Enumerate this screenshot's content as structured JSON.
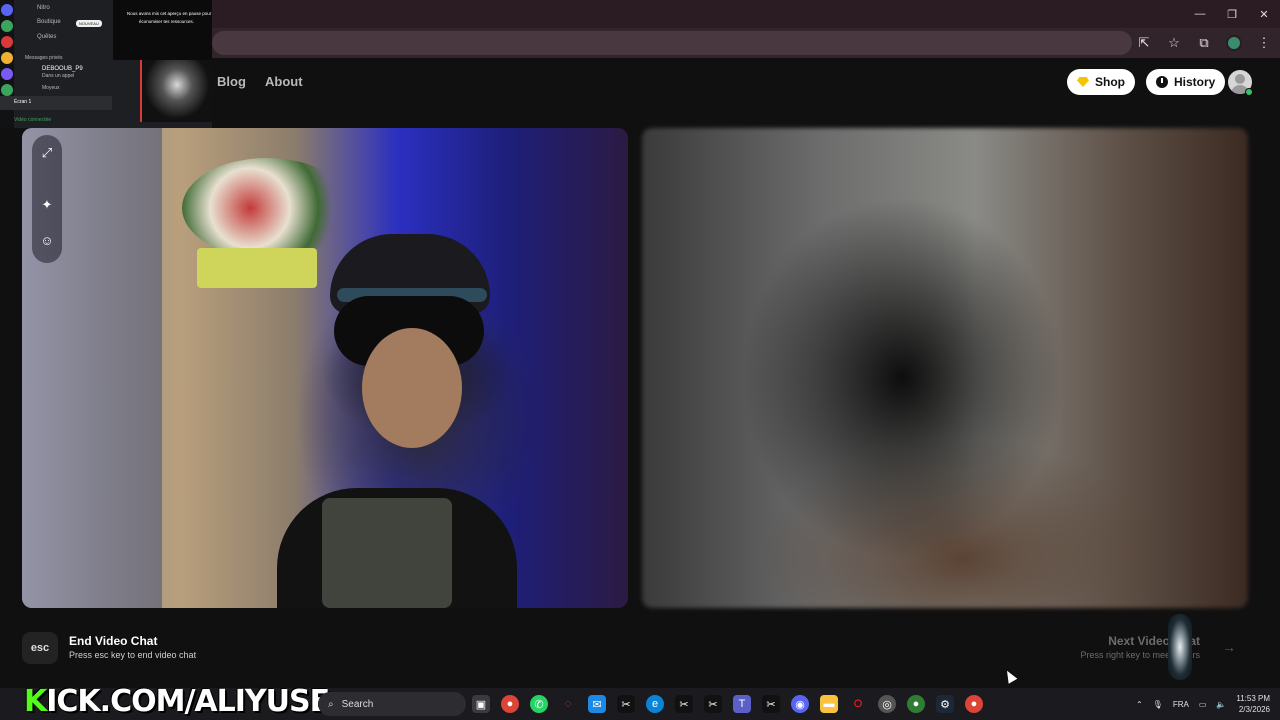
{
  "site_nav": {
    "blog": "Blog",
    "about": "About",
    "shop": "Shop",
    "history": "History"
  },
  "controls": {
    "end_key": "esc",
    "end_title": "End Video Chat",
    "end_sub": "Press esc key to end video chat",
    "next_title": "Next Video Chat",
    "next_sub": "Press right key to meet others"
  },
  "discord": {
    "nitro": "Nitro",
    "boutique": "Boutique",
    "badge_new": "NOUVEAU",
    "quetes": "Quêtes",
    "dm_header": "Messages privés",
    "dm_user": "DEBOOUB_P9",
    "dm_status": "Dans un appel",
    "dm_group": "Moyeux",
    "screen": "Écran 1",
    "video": "Vidéo connectée",
    "panel_line1": "Nous avons mis cet aperçu en pause pour",
    "panel_line2": "économiser tes ressources."
  },
  "overlay": {
    "kick_k": "K",
    "kick_rest": "ICK.COM/ALIYUSE"
  },
  "taskbar": {
    "search_placeholder": "Search",
    "lang": "FRA",
    "time": "11:53 PM",
    "date": "2/3/2026"
  },
  "colors": {
    "kick_green": "#53fc18",
    "online_green": "#35c46b",
    "shop_gem": "#f5c400"
  }
}
